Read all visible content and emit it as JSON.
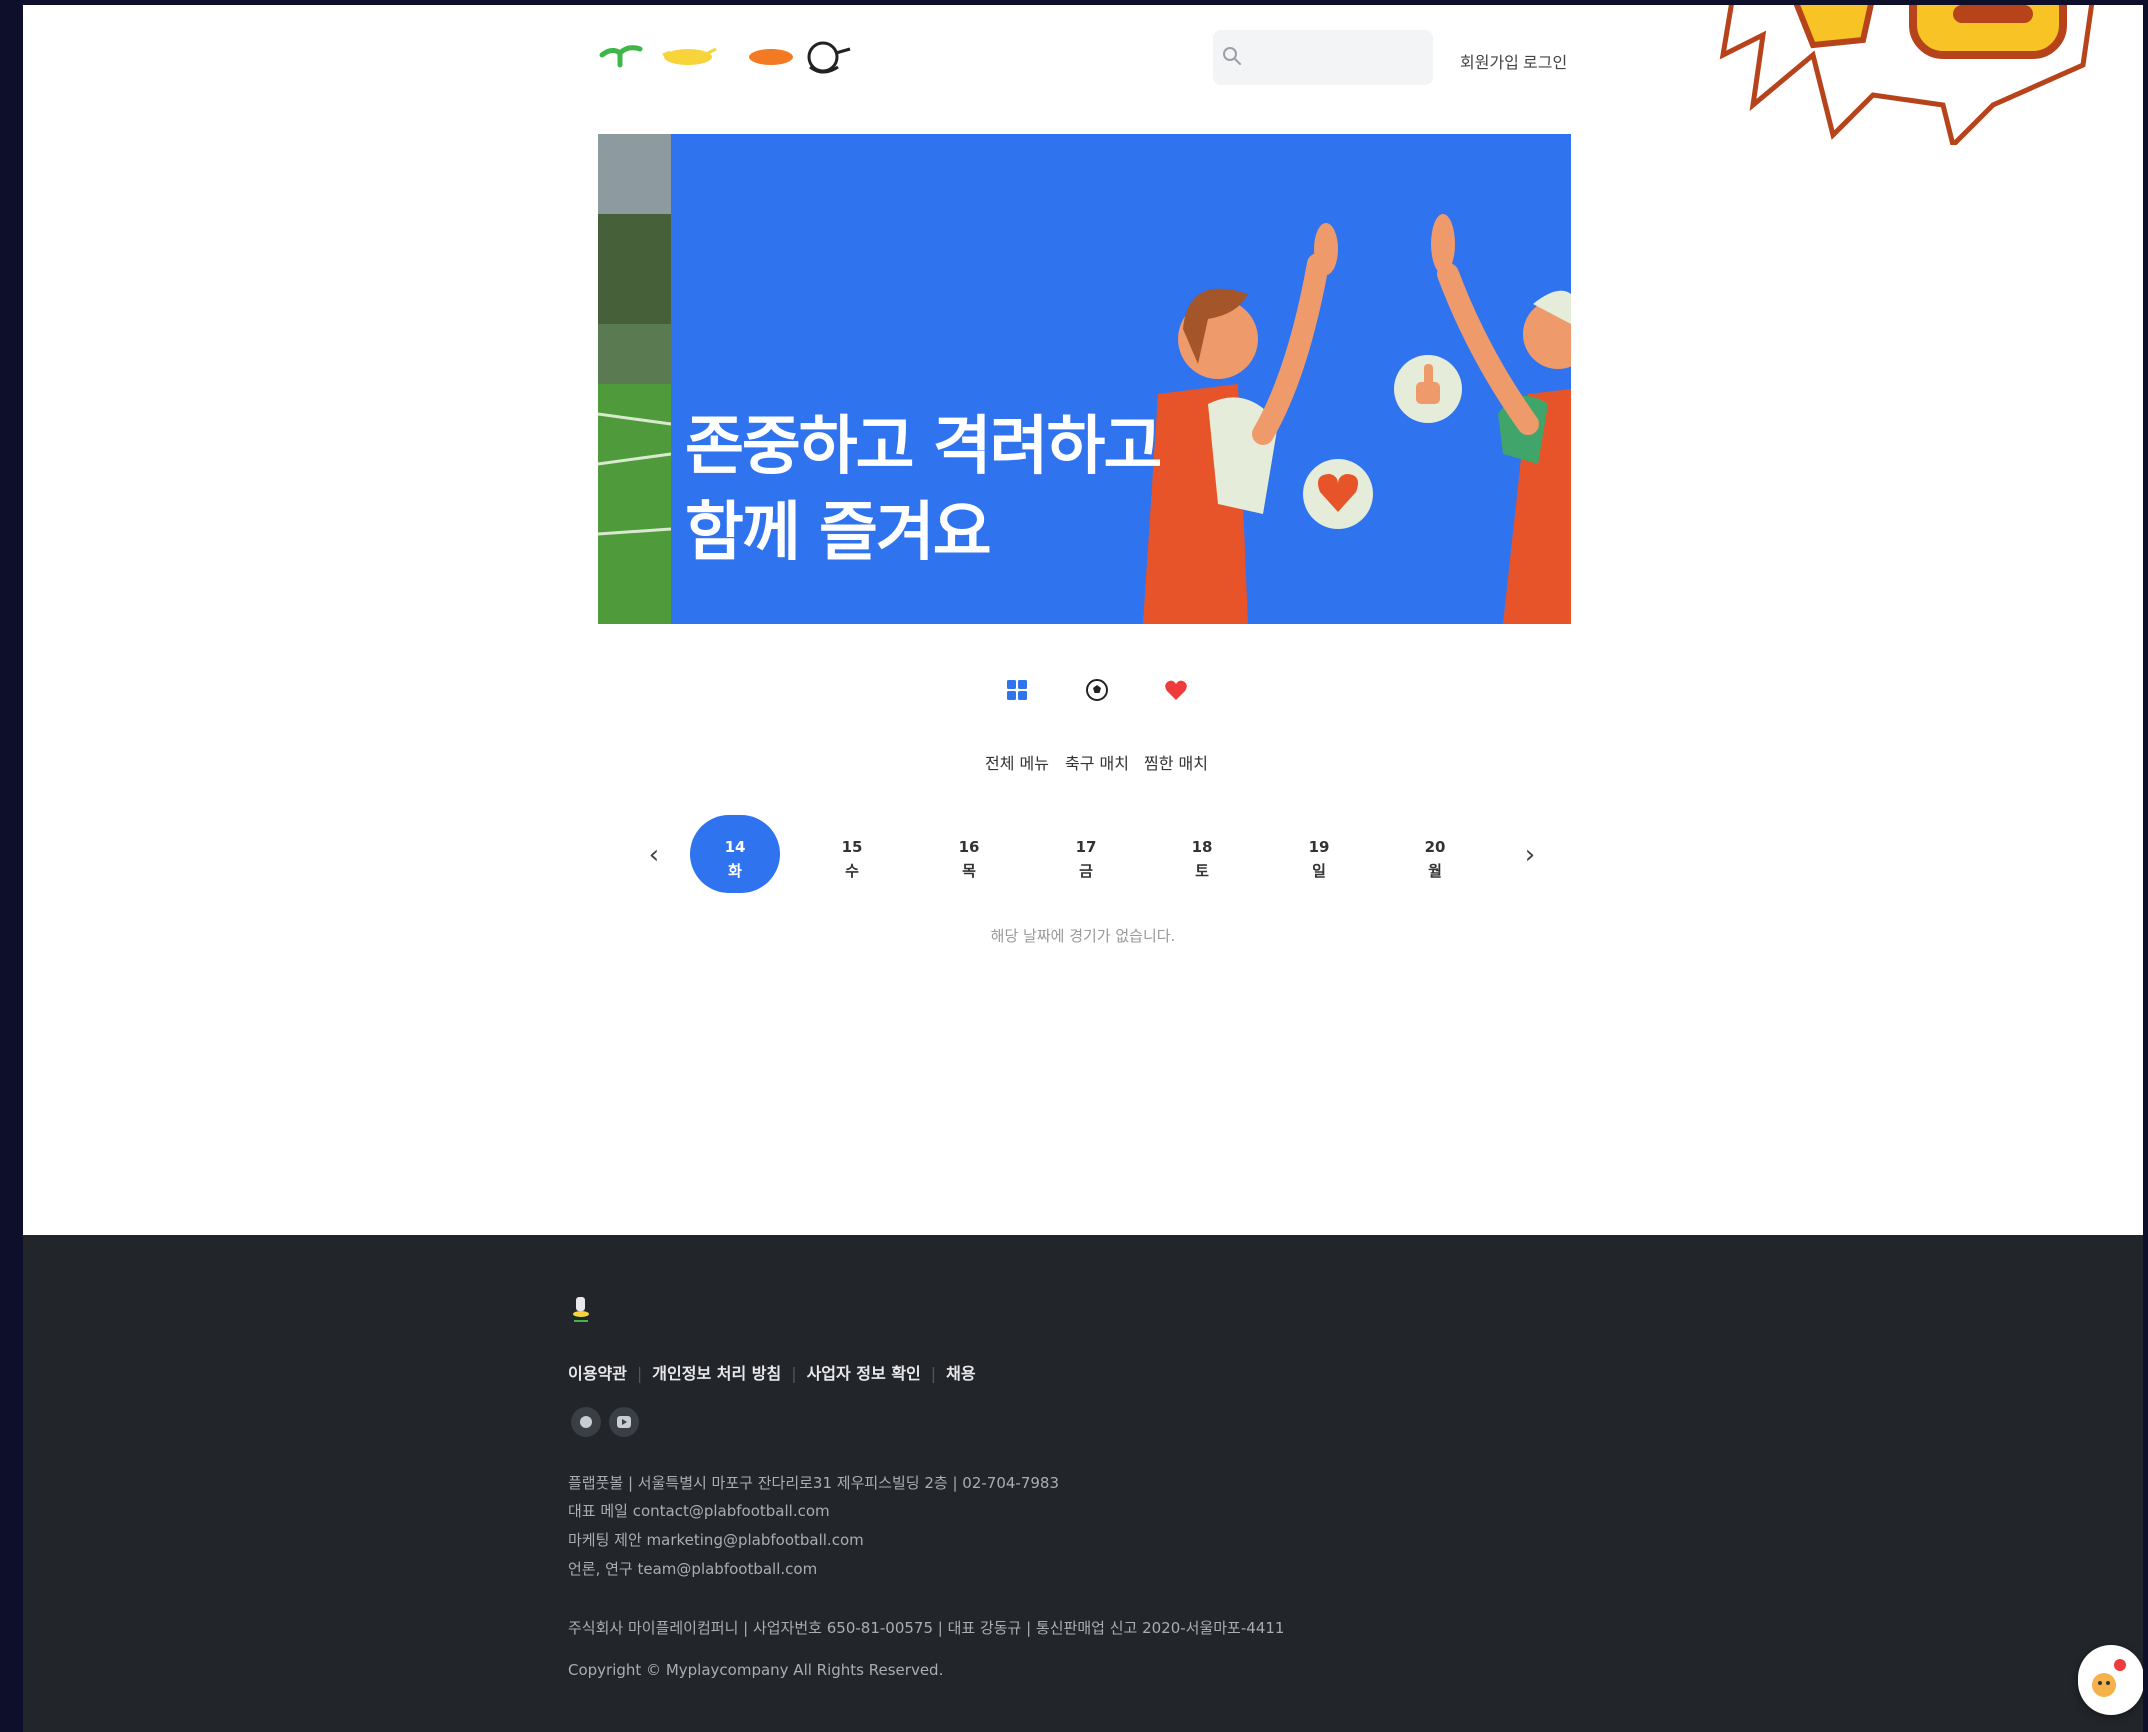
{
  "header": {
    "search_placeholder": "",
    "signup_label": "회원가입",
    "login_label": "로그인"
  },
  "banner": {
    "line1": "존중하고 격려하고",
    "line2": "함께 즐겨요"
  },
  "categories": [
    {
      "label": "전체 메뉴",
      "icon": "grid-icon"
    },
    {
      "label": "축구 매치",
      "icon": "soccer-ball-icon"
    },
    {
      "label": "찜한 매치",
      "icon": "heart-icon"
    }
  ],
  "dates": {
    "prev": "‹",
    "next": "›",
    "days": [
      {
        "num": "14",
        "dow": "화",
        "active": true
      },
      {
        "num": "15",
        "dow": "수"
      },
      {
        "num": "16",
        "dow": "목"
      },
      {
        "num": "17",
        "dow": "금"
      },
      {
        "num": "18",
        "dow": "토"
      },
      {
        "num": "19",
        "dow": "일"
      },
      {
        "num": "20",
        "dow": "월"
      }
    ],
    "empty_message": "해당 날짜에 경기가 없습니다."
  },
  "footer": {
    "links": [
      "이용약관",
      "개인정보 처리 방침",
      "사업자 정보 확인",
      "채용"
    ],
    "info": [
      "플랩풋볼 | 서울특별시 마포구 잔다리로31 제우피스빌딩 2층 | 02-704-7983",
      "대표 메일 contact@plabfootball.com",
      "마케팅 제안 marketing@plabfootball.com",
      "언론, 연구 team@plabfootball.com",
      "주식회사 마이플레이컴퍼니 | 사업자번호 650-81-00575 | 대표 강동규 | 통신판매업 신고 2020-서울마포-4411"
    ],
    "copyright": "Copyright © Myplaycompany All Rights Reserved."
  },
  "colors": {
    "accent": "#2f73ef",
    "footer_bg": "#22252a",
    "heart": "#ef3b3b",
    "outer_bg": "#0d0f2b"
  }
}
